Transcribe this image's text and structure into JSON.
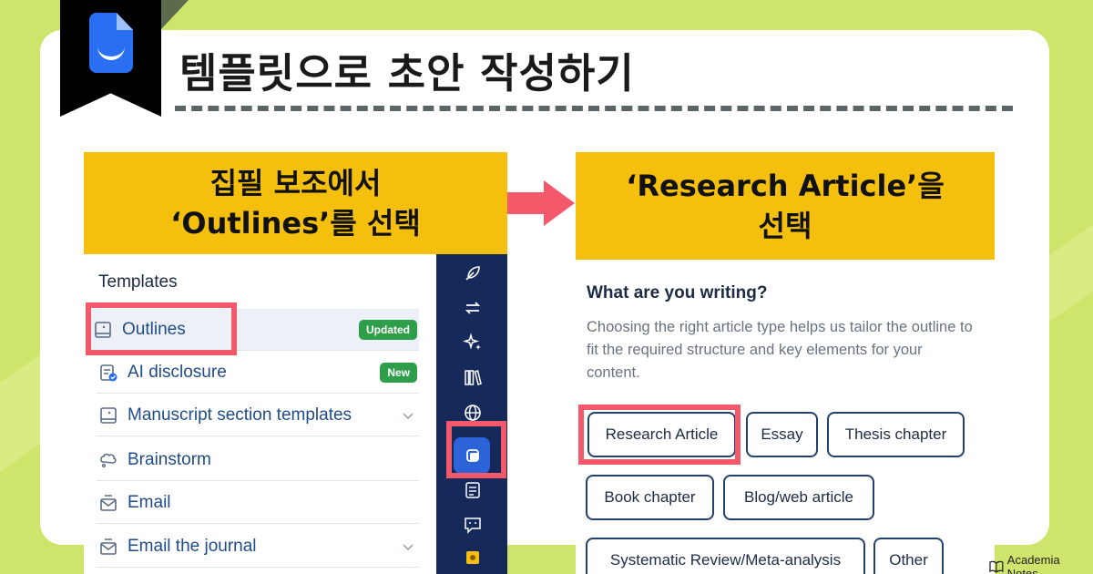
{
  "colors": {
    "background": "#cde56a",
    "step_header": "#f5c00d",
    "highlight": "#f4596b",
    "sidebar": "#15295a",
    "accent_blue": "#2a6ef2",
    "badge_green": "#2e9e4a"
  },
  "header": {
    "title": "템플릿으로 초안 작성하기",
    "logo_icon": "document-smile-icon"
  },
  "steps": [
    {
      "line1": "집필 보조에서",
      "line2": "‘Outlines’를 선택"
    },
    {
      "line1": "‘Research Article’을",
      "line2": "선택"
    }
  ],
  "templates": {
    "heading": "Templates",
    "items": [
      {
        "label": "Outlines",
        "badge": "Updated",
        "icon": "outline-doc-icon"
      },
      {
        "label": "AI disclosure",
        "badge": "New",
        "icon": "ai-disclosure-icon"
      },
      {
        "label": "Manuscript section templates",
        "icon": "manuscript-icon",
        "expandable": true
      },
      {
        "label": "Brainstorm",
        "icon": "brainstorm-icon"
      },
      {
        "label": "Email",
        "icon": "email-icon"
      },
      {
        "label": "Email the journal",
        "icon": "email-journal-icon",
        "expandable": true
      }
    ]
  },
  "sidebar_icons": [
    "feather-icon",
    "swap-icon",
    "sparkle-icon",
    "library-icon",
    "globe-icon",
    "templates-icon",
    "checklist-icon",
    "feedback-icon",
    "badge-icon"
  ],
  "writing_panel": {
    "question": "What are you writing?",
    "description": "Choosing the right article type helps us tailor the outline to fit the required structure and key elements for your content.",
    "options": [
      "Research Article",
      "Essay",
      "Thesis chapter",
      "Book chapter",
      "Blog/web article",
      "Systematic Review/Meta-analysis",
      "Other"
    ]
  },
  "brand": {
    "name": "Academia Notes"
  }
}
